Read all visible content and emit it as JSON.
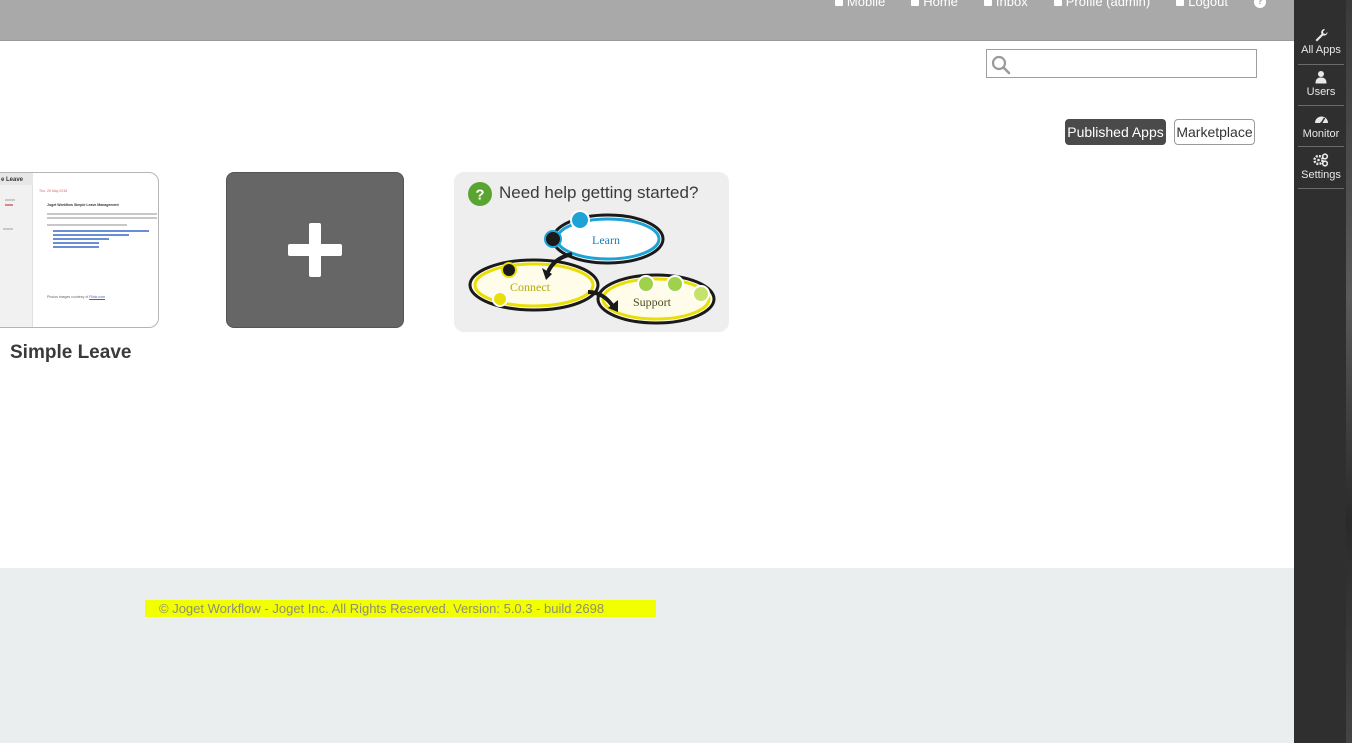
{
  "topnav": {
    "items": [
      "Mobile",
      "Home",
      "Inbox",
      "Profile (admin)",
      "Logout"
    ],
    "help": "?"
  },
  "search": {
    "placeholder": "",
    "value": ""
  },
  "tabs": {
    "published": "Published Apps",
    "marketplace": "Marketplace"
  },
  "apps": [
    {
      "title": "Simple Leave"
    }
  ],
  "thumbnail": {
    "header": "e Leave",
    "date": "Thu, 25 May 2016",
    "heading": "Joget Workflow Simple Leave Management",
    "footer_text": "Photos images courtesy of",
    "footer_link": "Flickr.com"
  },
  "help_card": {
    "title": "Need help getting started?",
    "learn": "Learn",
    "connect": "Connect",
    "support": "Support"
  },
  "footer": {
    "copyright": "© Joget Workflow - Joget Inc. All Rights Reserved. Version: 5.0.3 - build 2698"
  },
  "sidebar": {
    "items": [
      {
        "label": "All Apps",
        "icon": "wrench-icon"
      },
      {
        "label": "Users",
        "icon": "user-icon"
      },
      {
        "label": "Monitor",
        "icon": "dashboard-icon"
      },
      {
        "label": "Settings",
        "icon": "gears-icon"
      }
    ]
  },
  "colors": {
    "topbar": "#a9a9a9",
    "sidebar": "#2f2f2f",
    "highlight": "#f2ff00",
    "tab_active": "#4a4a4a"
  }
}
